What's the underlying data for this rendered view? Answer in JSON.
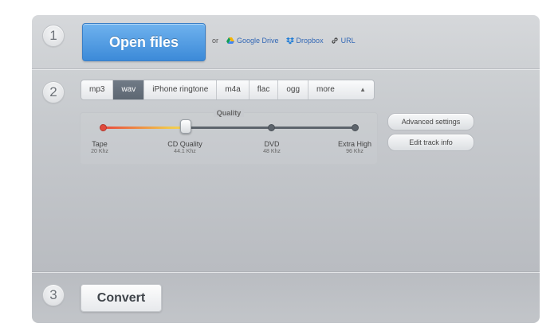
{
  "steps": [
    "1",
    "2",
    "3"
  ],
  "open": {
    "label": "Open files"
  },
  "sources": {
    "or_label": "or",
    "items": [
      {
        "label": "Google Drive",
        "icon": "google-drive-icon"
      },
      {
        "label": "Dropbox",
        "icon": "dropbox-icon"
      },
      {
        "label": "URL",
        "icon": "link-icon"
      }
    ]
  },
  "formats": {
    "items": [
      "mp3",
      "wav",
      "iPhone ringtone",
      "m4a",
      "flac",
      "ogg"
    ],
    "active": "wav",
    "more_label": "more"
  },
  "quality": {
    "title": "Quality",
    "selected_index": 1,
    "stops": [
      {
        "name": "Tape",
        "rate": "20 Khz"
      },
      {
        "name": "CD Quality",
        "rate": "44.1 Khz"
      },
      {
        "name": "DVD",
        "rate": "48 Khz"
      },
      {
        "name": "Extra High",
        "rate": "96 Khz"
      }
    ]
  },
  "buttons": {
    "advanced": "Advanced settings",
    "edit_track": "Edit track info",
    "convert": "Convert"
  },
  "colors": {
    "accent_blue": "#4a96e0",
    "link_blue": "#3368b5",
    "track_red": "#e14a3c",
    "track_yellow": "#f1c64c"
  }
}
